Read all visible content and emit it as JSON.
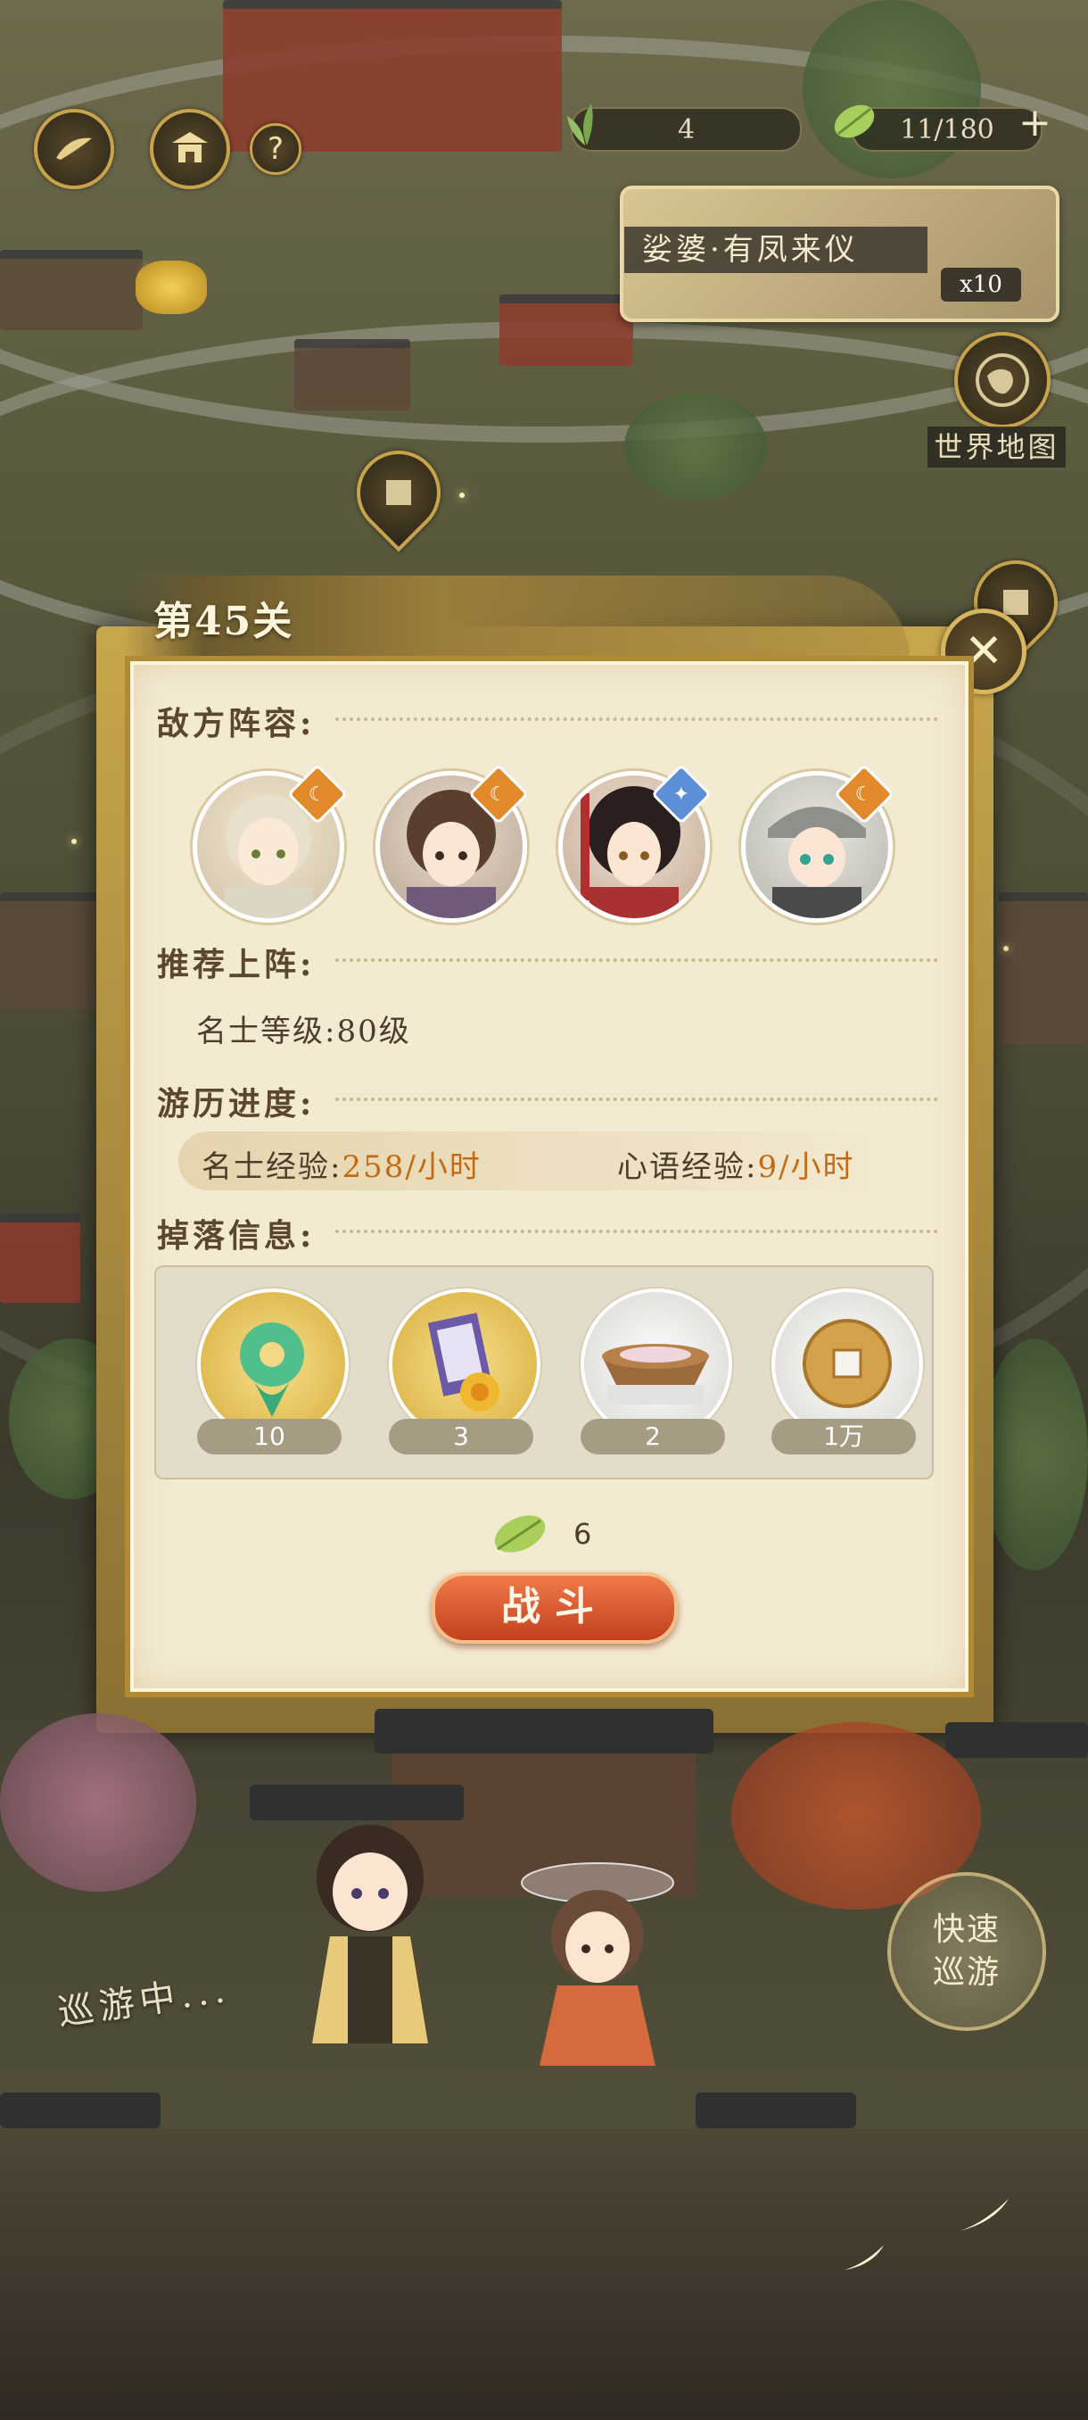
{
  "hud": {
    "help_icon": "question-mark-icon",
    "stamina": "4",
    "jade_leaves": "11/180",
    "add_label": "+"
  },
  "event": {
    "title": "娑婆·有凤来仪",
    "count": "x10"
  },
  "world_map": {
    "label": "世界地图",
    "icon": "world-map-icon"
  },
  "dialog": {
    "level_title": "第45关",
    "close_icon": "close-icon",
    "enemy_label": "敌方阵容:",
    "enemies": [
      {
        "name": "enemy-avatar-1",
        "badge_color": "#e28a2b",
        "badge_icon": "moon-icon"
      },
      {
        "name": "enemy-avatar-2",
        "badge_color": "#e28a2b",
        "badge_icon": "moon-icon"
      },
      {
        "name": "enemy-avatar-3",
        "badge_color": "#5c8fd8",
        "badge_icon": "star-icon"
      },
      {
        "name": "enemy-avatar-4",
        "badge_color": "#e28a2b",
        "badge_icon": "moon-icon"
      }
    ],
    "recommend_label": "推荐上阵:",
    "level_req_label": "名士等级:",
    "level_req_value": "80级",
    "progress_label": "游历进度:",
    "mingshi_exp_label": "名士经验:",
    "mingshi_exp_value": "258/小时",
    "xinyu_exp_label": "心语经验:",
    "xinyu_exp_value": "9/小时",
    "drop_label": "掉落信息:",
    "drops": [
      {
        "icon": "jade-pendant-icon",
        "qty": "10"
      },
      {
        "icon": "book-scroll-icon",
        "qty": "3"
      },
      {
        "icon": "rice-bowl-icon",
        "qty": "2"
      },
      {
        "icon": "copper-coin-icon",
        "qty": "1万"
      }
    ],
    "cost_value": "6",
    "fight_label": "战斗"
  },
  "quick_tour": {
    "line1": "快速",
    "line2": "巡游"
  },
  "touring_status": "巡游中...",
  "colors": {
    "accent_gold": "#c9a24c",
    "fight_orange": "#d9552a",
    "exp_orange": "#c46a12",
    "panel_bg": "#f3ead2"
  }
}
